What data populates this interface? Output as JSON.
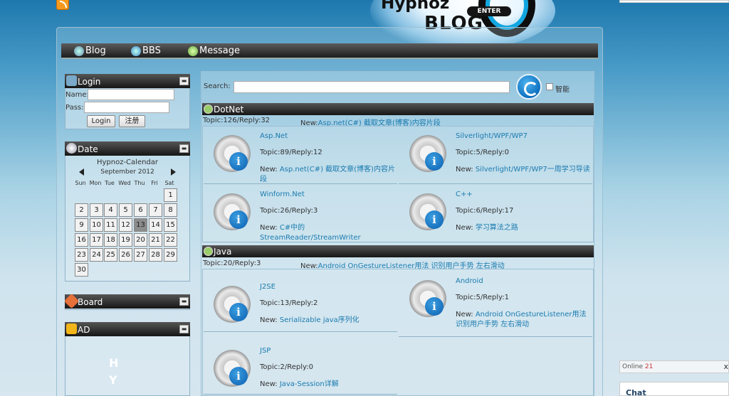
{
  "header": {
    "logo_top": "Hypnoz",
    "logo_bottom": "BLOG",
    "enter_label": "ENTER"
  },
  "nav": {
    "items": [
      {
        "label": "Blog",
        "icon": "blog-icon"
      },
      {
        "label": "BBS",
        "icon": "bbs-icon"
      },
      {
        "label": "Message",
        "icon": "message-icon"
      }
    ]
  },
  "login": {
    "title": "Login",
    "name_label": "Name:",
    "pass_label": "Pass:",
    "name_value": "",
    "pass_value": "",
    "login_button": "Login",
    "register_button": "注册"
  },
  "date": {
    "title": "Date",
    "calendar_title": "Hypnoz-Calendar",
    "month_label": "September 2012",
    "weekdays": [
      "Sun",
      "Mon",
      "Tue",
      "Wed",
      "Thu",
      "Fri",
      "Sat"
    ],
    "days": [
      "1",
      "2",
      "3",
      "4",
      "5",
      "6",
      "7",
      "8",
      "9",
      "10",
      "11",
      "12",
      "13",
      "14",
      "15",
      "16",
      "17",
      "18",
      "19",
      "20",
      "21",
      "22",
      "23",
      "24",
      "25",
      "26",
      "27",
      "28",
      "29",
      "30"
    ],
    "today": "13"
  },
  "board_panel": {
    "title": "Board"
  },
  "ad_panel": {
    "title": "AD",
    "vertical_text": "HY"
  },
  "search": {
    "label": "Search:",
    "value": "",
    "checkbox_label": "智能"
  },
  "sections": [
    {
      "title": "DotNet",
      "stats": "Topic:126/Reply:32",
      "new_prefix": "New:",
      "new_link": "Asp.net(C#) 截取文章(博客)内容片段",
      "boards": [
        {
          "name": "Asp.Net",
          "stats": "Topic:89/Reply:12",
          "new_prefix": "New: ",
          "new_link": "Asp.net(C#) 截取文章(博客)内容片段"
        },
        {
          "name": "Silverlight/WPF/WP7",
          "stats": "Topic:5/Reply:0",
          "new_prefix": "New: ",
          "new_link": "Silverlight/WPF/WP7一周学习导读"
        },
        {
          "name": "Winform.Net",
          "stats": "Topic:26/Reply:3",
          "new_prefix": "New: ",
          "new_link": "C#中的StreamReader/StreamWriter"
        },
        {
          "name": "C++",
          "stats": "Topic:6/Reply:17",
          "new_prefix": "New: ",
          "new_link": "学习算法之路"
        }
      ]
    },
    {
      "title": "Java",
      "stats": "Topic:20/Reply:3",
      "new_prefix": "New:",
      "new_link": "Android OnGestureListener用法 识别用户手势 左右滑动",
      "boards": [
        {
          "name": "J2SE",
          "stats": "Topic:13/Reply:2",
          "new_prefix": "New: ",
          "new_link": "Serializable java序列化"
        },
        {
          "name": "Android",
          "stats": "Topic:5/Reply:1",
          "new_prefix": "New: ",
          "new_link": "Android OnGestureListener用法 识别用户手势 左右滑动"
        },
        {
          "name": "JSP",
          "stats": "Topic:2/Reply:0",
          "new_prefix": "New: ",
          "new_link": "Java-Session详解"
        }
      ]
    }
  ],
  "online": {
    "label": "Online",
    "count": "21",
    "close": "x"
  },
  "chat": {
    "label": "Chat"
  }
}
